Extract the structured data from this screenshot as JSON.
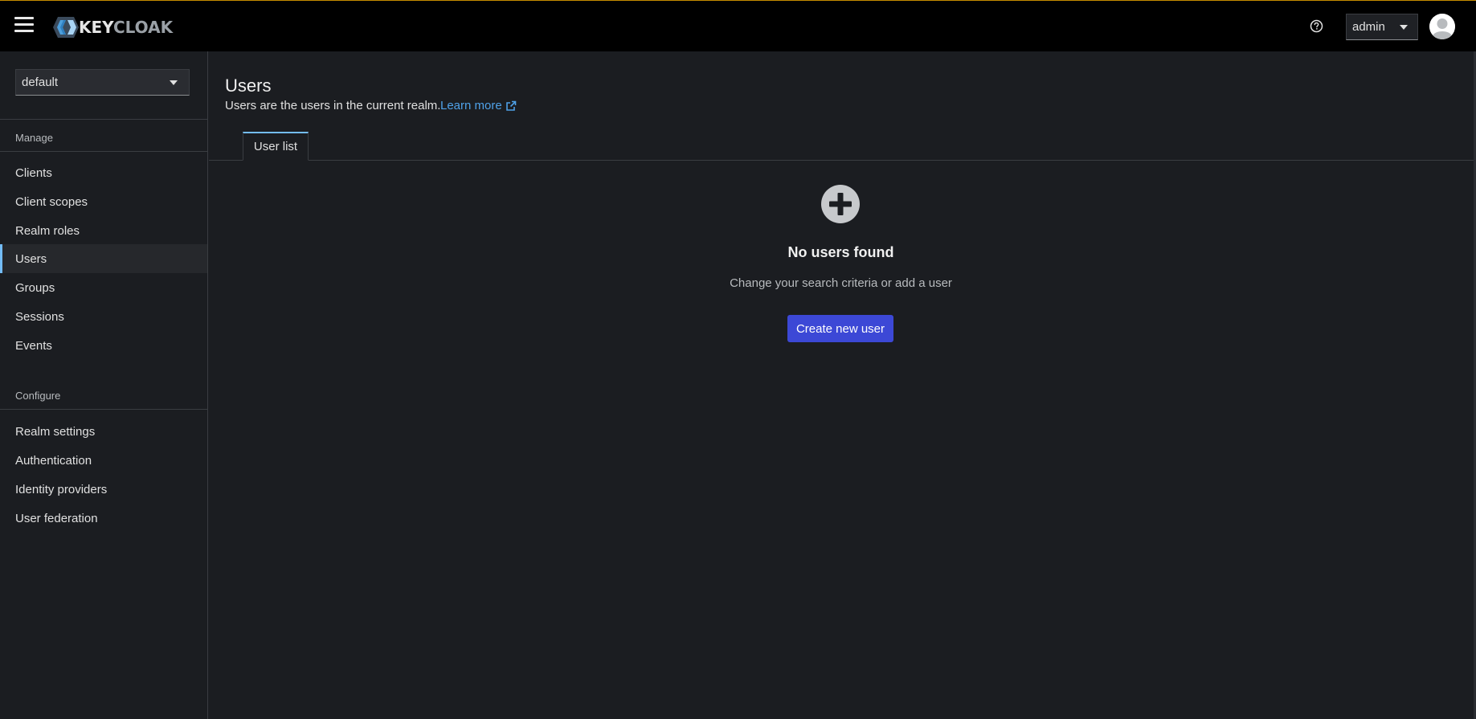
{
  "header": {
    "logo_main": "KEY",
    "logo_accent": "CLOAK",
    "user_label": "admin",
    "help_icon": "question-circle-icon",
    "avatar_icon": "user-avatar-icon",
    "accent_color": "#c58c00"
  },
  "sidebar": {
    "realm": "default",
    "sections": {
      "manage": "Manage",
      "configure": "Configure"
    },
    "manage_items": [
      {
        "label": "Clients"
      },
      {
        "label": "Client scopes"
      },
      {
        "label": "Realm roles"
      },
      {
        "label": "Users"
      },
      {
        "label": "Groups"
      },
      {
        "label": "Sessions"
      },
      {
        "label": "Events"
      }
    ],
    "active_item": "Users",
    "configure_items": [
      {
        "label": "Realm settings"
      },
      {
        "label": "Authentication"
      },
      {
        "label": "Identity providers"
      },
      {
        "label": "User federation"
      }
    ]
  },
  "main": {
    "title": "Users",
    "description": "Users are the users in the current realm.",
    "learn_more": "Learn more",
    "tabs": [
      {
        "label": "User list",
        "active": true
      }
    ],
    "empty_state": {
      "icon": "plus-circle-icon",
      "title": "No users found",
      "body": "Change your search criteria or add a user",
      "button": "Create new user"
    }
  },
  "colors": {
    "primary_button": "#3c48d6",
    "link": "#4fa1e8",
    "active_indicator": "#73bcf7",
    "background": "#1b1d21"
  }
}
